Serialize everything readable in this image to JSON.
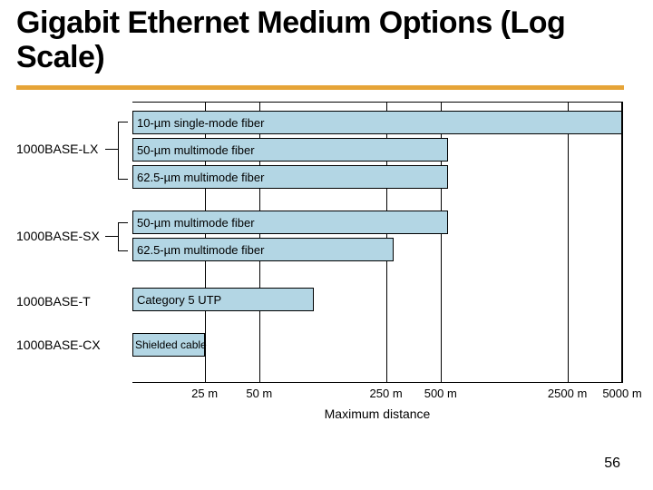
{
  "title": "Gigabit Ethernet Medium Options (Log Scale)",
  "page_number": "56",
  "chart_data": {
    "type": "bar",
    "xlabel": "Maximum distance",
    "x_scale": "log",
    "x_domain_meters": [
      10,
      5000
    ],
    "x_tick_labels": [
      "25 m",
      "50 m",
      "250 m",
      "500 m",
      "2500 m",
      "5000 m"
    ],
    "x_tick_values": [
      25,
      50,
      250,
      500,
      2500,
      5000
    ],
    "groups": [
      {
        "name": "1000BASE-LX",
        "bars": [
          {
            "label": "10-µm single-mode fiber",
            "distance_m": 5000
          },
          {
            "label": "50-µm multimode fiber",
            "distance_m": 550
          },
          {
            "label": "62.5-µm multimode fiber",
            "distance_m": 550
          }
        ]
      },
      {
        "name": "1000BASE-SX",
        "bars": [
          {
            "label": "50-µm multimode fiber",
            "distance_m": 550
          },
          {
            "label": "62.5-µm multimode fiber",
            "distance_m": 275
          }
        ]
      },
      {
        "name": "1000BASE-T",
        "bars": [
          {
            "label": "Category 5 UTP",
            "distance_m": 100
          }
        ]
      },
      {
        "name": "1000BASE-CX",
        "bars": [
          {
            "label": "Shielded cable",
            "distance_m": 25
          }
        ]
      }
    ]
  }
}
